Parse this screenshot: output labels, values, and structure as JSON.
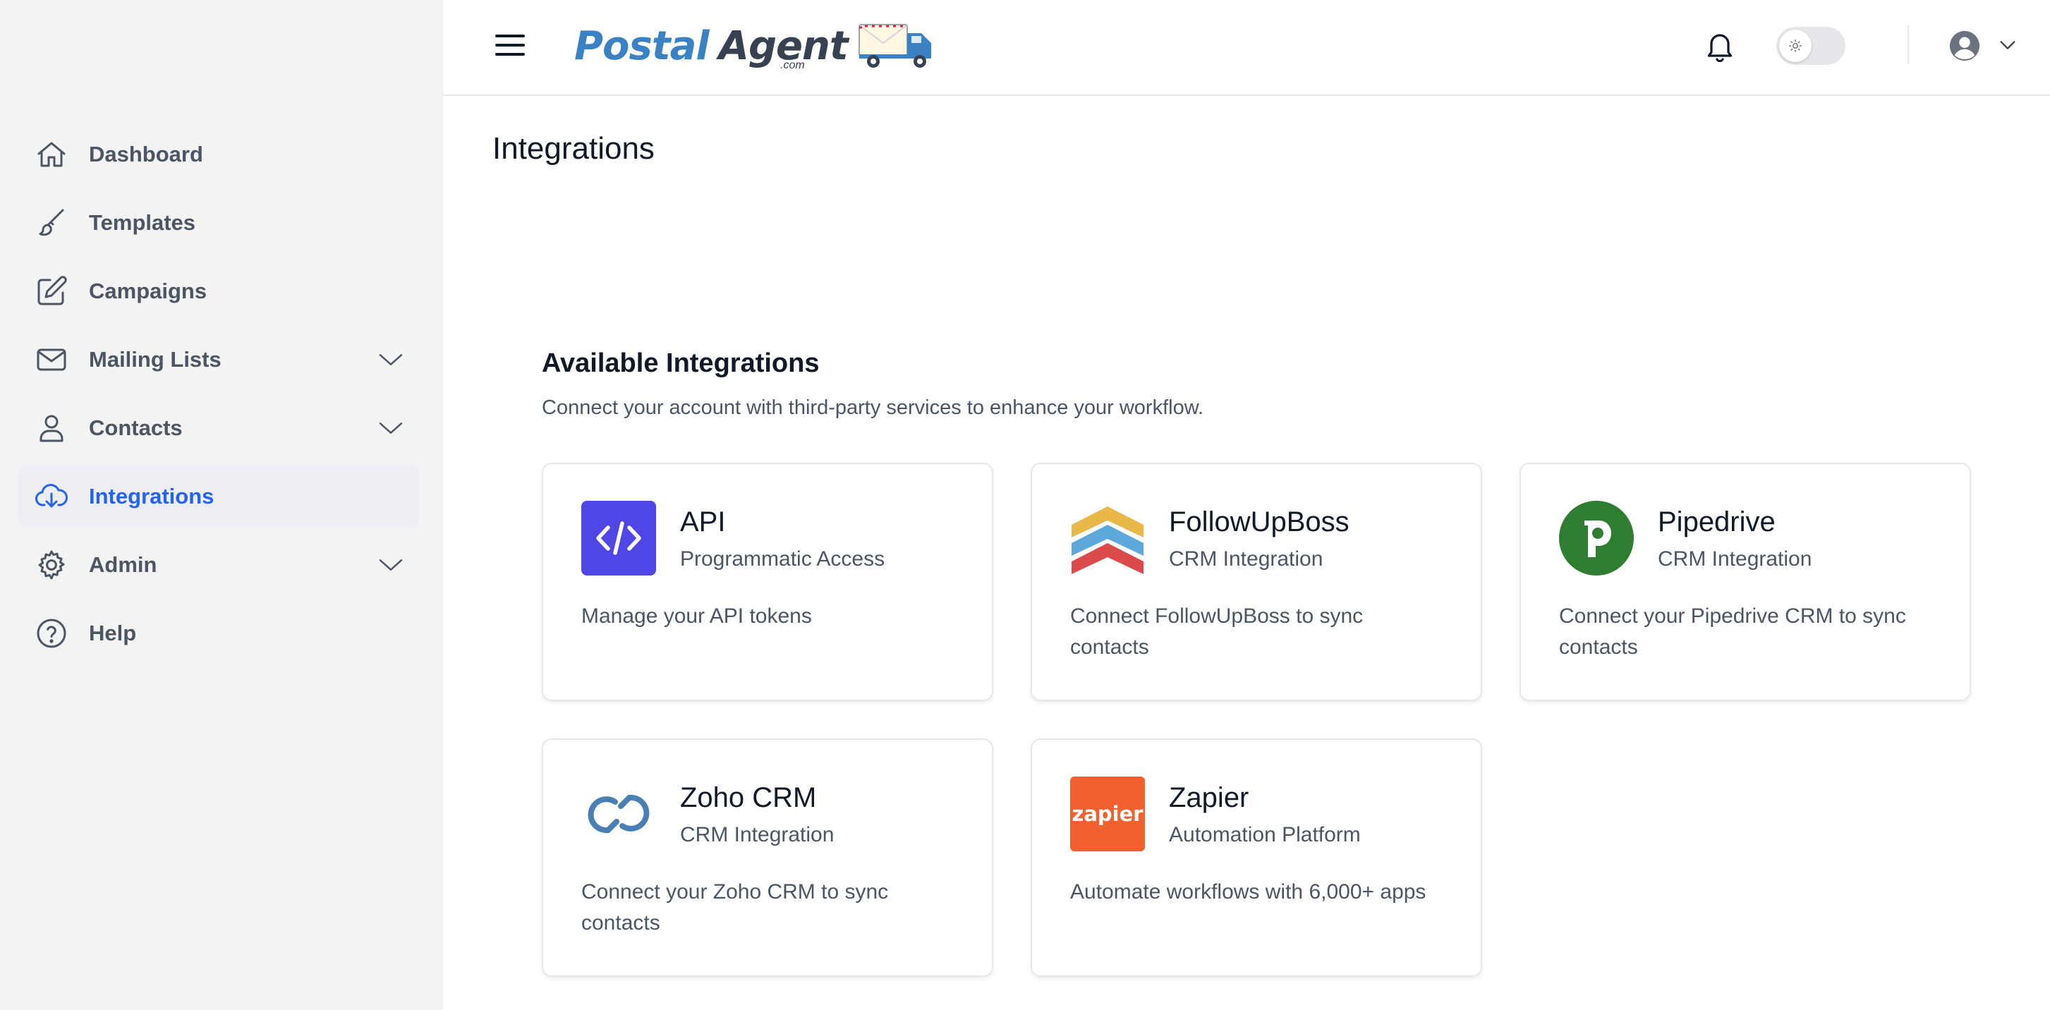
{
  "sidebar": {
    "items": [
      {
        "label": "Dashboard",
        "icon": "home-icon"
      },
      {
        "label": "Templates",
        "icon": "brush-icon"
      },
      {
        "label": "Campaigns",
        "icon": "edit-icon"
      },
      {
        "label": "Mailing Lists",
        "icon": "mail-icon",
        "expandable": true
      },
      {
        "label": "Contacts",
        "icon": "user-icon",
        "expandable": true
      },
      {
        "label": "Integrations",
        "icon": "cloud-download-icon",
        "active": true
      },
      {
        "label": "Admin",
        "icon": "gear-icon",
        "expandable": true
      },
      {
        "label": "Help",
        "icon": "help-circle-icon"
      }
    ]
  },
  "header": {
    "logo": {
      "postal": "Postal",
      "agent": "Agent",
      "dotcom": ".com"
    },
    "icons": [
      "menu-icon",
      "bell-icon",
      "sun-icon",
      "user-avatar-icon",
      "chevron-down-icon"
    ],
    "theme_toggle": "light"
  },
  "page": {
    "title": "Integrations"
  },
  "integrations": {
    "title": "Available Integrations",
    "subtitle": "Connect your account with third-party services to enhance your workflow.",
    "cards": [
      {
        "title": "API",
        "subtitle": "Programmatic Access",
        "description": "Manage your API tokens",
        "icon": "code-icon"
      },
      {
        "title": "FollowUpBoss",
        "subtitle": "CRM Integration",
        "description": "Connect FollowUpBoss to sync contacts",
        "icon": "followupboss-logo-icon"
      },
      {
        "title": "Pipedrive",
        "subtitle": "CRM Integration",
        "description": "Connect your Pipedrive CRM to sync contacts",
        "icon": "pipedrive-logo-icon"
      },
      {
        "title": "Zoho CRM",
        "subtitle": "CRM Integration",
        "description": "Connect your Zoho CRM to sync contacts",
        "icon": "zoho-logo-icon"
      },
      {
        "title": "Zapier",
        "subtitle": "Automation Platform",
        "description": "Automate workflows with 6,000+ apps",
        "icon": "zapier-logo-icon",
        "logo_text": "zapier"
      }
    ]
  },
  "colors": {
    "accent": "#2563eb",
    "sidebar_bg": "#f3f3f3",
    "api": "#4f46e5",
    "pipedrive": "#2e7d32",
    "zapier": "#f0612e",
    "zoho": "#4a7fb5"
  }
}
